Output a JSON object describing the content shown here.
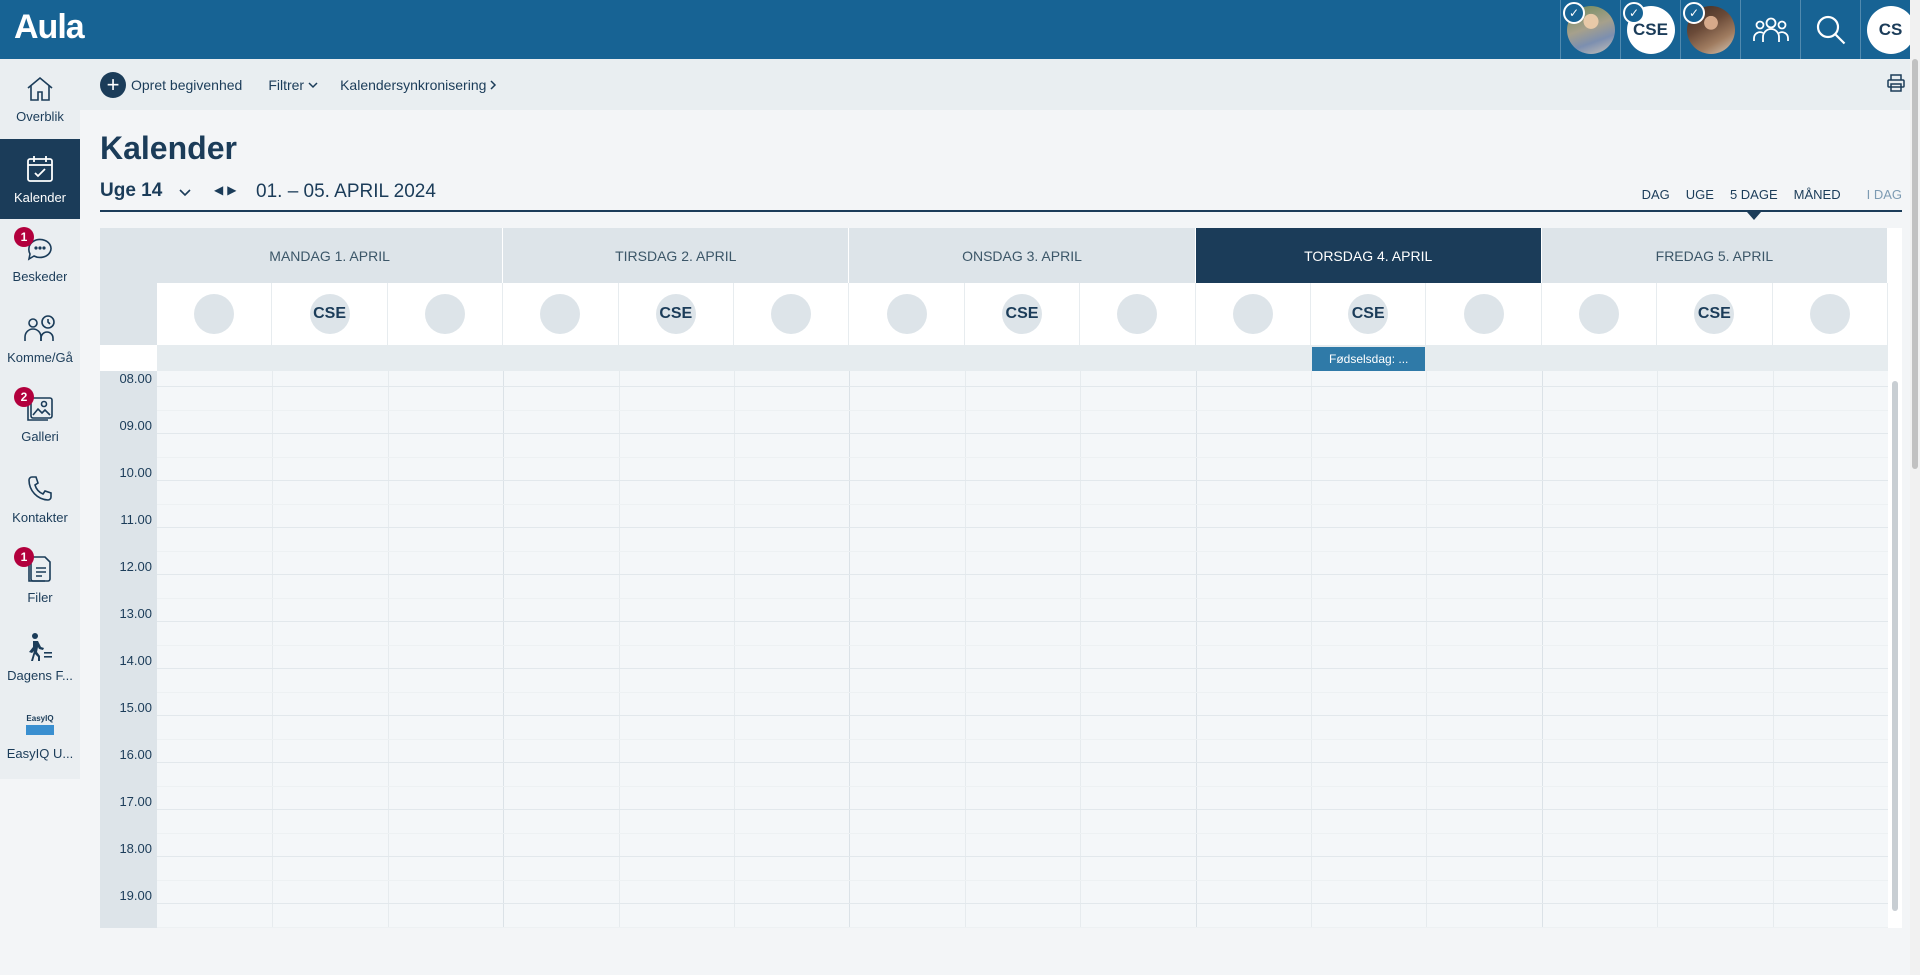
{
  "app": {
    "logo": "Aula"
  },
  "topbar": {
    "profiles": [
      {
        "type": "photo",
        "label": ""
      },
      {
        "type": "initials",
        "label": "CSE"
      },
      {
        "type": "photo",
        "label": ""
      }
    ],
    "user_initials": "CS"
  },
  "sidebar": {
    "items": [
      {
        "label": "Overblik",
        "icon": "home-icon",
        "badge": ""
      },
      {
        "label": "Kalender",
        "icon": "calendar-icon",
        "badge": "",
        "active": true
      },
      {
        "label": "Beskeder",
        "icon": "chat-icon",
        "badge": "1"
      },
      {
        "label": "Komme/Gå",
        "icon": "people-clock-icon",
        "badge": ""
      },
      {
        "label": "Galleri",
        "icon": "gallery-icon",
        "badge": "2"
      },
      {
        "label": "Kontakter",
        "icon": "phone-icon",
        "badge": ""
      },
      {
        "label": "Filer",
        "icon": "files-icon",
        "badge": "1"
      },
      {
        "label": "Dagens F...",
        "icon": "walking-person-icon",
        "badge": ""
      },
      {
        "label": "EasyIQ U...",
        "icon": "easyiq-icon",
        "badge": ""
      }
    ],
    "easyiq_logo": "EasyIQ"
  },
  "actions": {
    "create": "Opret begivenhed",
    "filter": "Filtrer",
    "sync": "Kalendersynkronisering"
  },
  "page": {
    "title": "Kalender",
    "week": "Uge 14",
    "range": "01. – 05. APRIL 2024"
  },
  "views": [
    "DAG",
    "UGE",
    "5 DAGE",
    "MÅNED",
    "I DAG"
  ],
  "active_view": "5 DAGE",
  "calendar": {
    "days": [
      "MANDAG 1. APRIL",
      "TIRSDAG 2. APRIL",
      "ONSDAG 3. APRIL",
      "TORSDAG 4. APRIL",
      "FREDAG 5. APRIL"
    ],
    "today_index": 3,
    "participant_labels": [
      "",
      "CSE",
      ""
    ],
    "times": [
      "08.00",
      "09.00",
      "10.00",
      "11.00",
      "12.00",
      "13.00",
      "14.00",
      "15.00",
      "16.00",
      "17.00",
      "18.00",
      "19.00"
    ],
    "allday_event": {
      "label": "Fødselsdag: ...",
      "day_index": 3,
      "participant_index": 1
    }
  },
  "colors": {
    "primary": "#176394",
    "dark": "#1b3c59",
    "badge": "#b2003d",
    "event": "#2f7aa8"
  }
}
